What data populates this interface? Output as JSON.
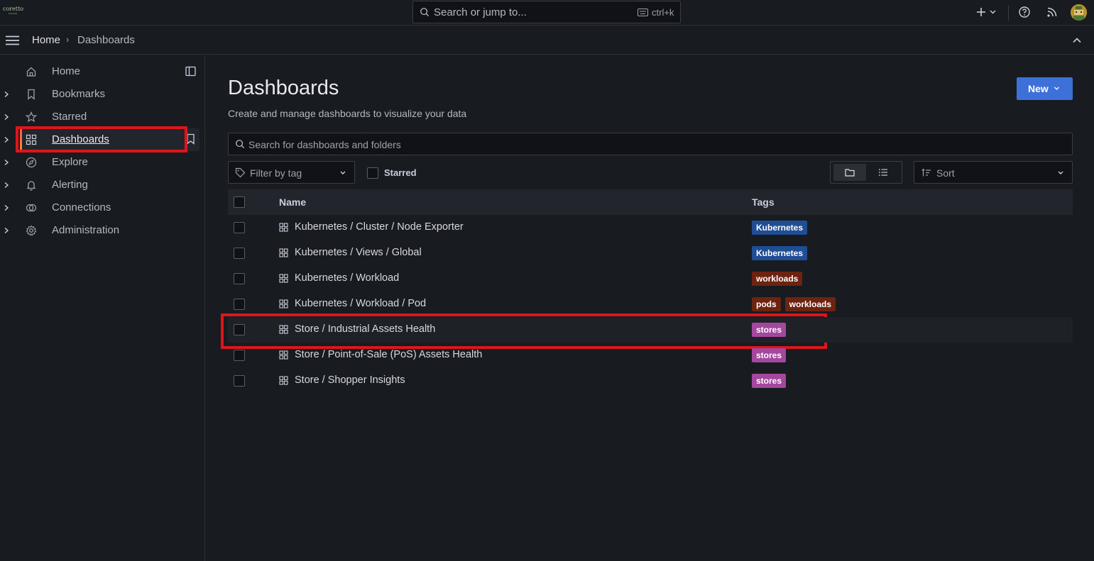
{
  "topbar": {
    "logo_text": "coretto",
    "logo_subtext": "industrial",
    "search_placeholder": "Search or jump to...",
    "search_shortcut": "ctrl+k"
  },
  "breadcrumb": {
    "home": "Home",
    "separator": "›",
    "current": "Dashboards"
  },
  "sidebar": {
    "items": [
      {
        "label": "Home",
        "icon": "home-icon"
      },
      {
        "label": "Bookmarks",
        "icon": "bookmark-icon"
      },
      {
        "label": "Starred",
        "icon": "star-icon"
      },
      {
        "label": "Dashboards",
        "icon": "apps-icon"
      },
      {
        "label": "Explore",
        "icon": "compass-icon"
      },
      {
        "label": "Alerting",
        "icon": "bell-icon"
      },
      {
        "label": "Connections",
        "icon": "connections-icon"
      },
      {
        "label": "Administration",
        "icon": "cog-icon"
      }
    ]
  },
  "main": {
    "title": "Dashboards",
    "subtitle": "Create and manage dashboards to visualize your data",
    "new_label": "New",
    "search_placeholder": "Search for dashboards and folders",
    "tag_filter_placeholder": "Filter by tag",
    "starred_label": "Starred",
    "sort_label": "Sort",
    "columns": {
      "name": "Name",
      "tags": "Tags"
    },
    "rows": [
      {
        "name": "Kubernetes / Cluster / Node Exporter",
        "tags": [
          {
            "label": "Kubernetes",
            "color": "#1f4e95"
          }
        ]
      },
      {
        "name": "Kubernetes / Views / Global",
        "tags": [
          {
            "label": "Kubernetes",
            "color": "#1f4e95"
          }
        ]
      },
      {
        "name": "Kubernetes / Workload",
        "tags": [
          {
            "label": "workloads",
            "color": "#6e2210"
          }
        ]
      },
      {
        "name": "Kubernetes / Workload / Pod",
        "tags": [
          {
            "label": "pods",
            "color": "#6e2210"
          },
          {
            "label": "workloads",
            "color": "#6e2210"
          }
        ]
      },
      {
        "name": "Store / Industrial Assets Health",
        "tags": [
          {
            "label": "stores",
            "color": "#a3479f"
          }
        ]
      },
      {
        "name": "Store / Point-of-Sale (PoS) Assets Health",
        "tags": [
          {
            "label": "stores",
            "color": "#a3479f"
          }
        ]
      },
      {
        "name": "Store / Shopper Insights",
        "tags": [
          {
            "label": "stores",
            "color": "#a3479f"
          }
        ]
      }
    ]
  },
  "colors": {
    "accent": "#3d71d9",
    "highlight": "#e0151b",
    "background": "#181b1f"
  }
}
